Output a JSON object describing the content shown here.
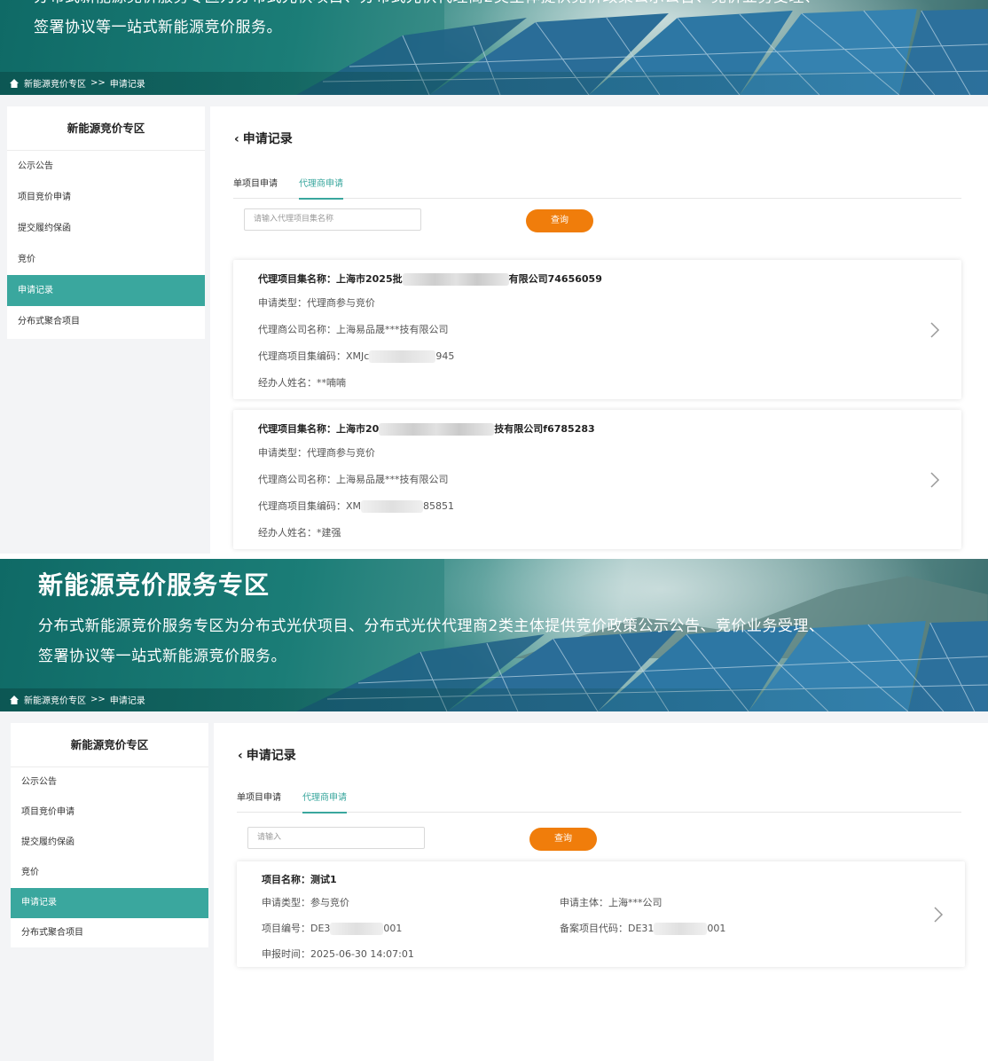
{
  "banner": {
    "title": "新能源竞价服务专区",
    "description": "分布式新能源竞价服务专区为分布式光伏项目、分布式光伏代理商2类主体提供竞价政策公示公告、竞价业务受理、签署协议等一站式新能源竞价服务。",
    "breadcrumb_root": "新能源竞价专区",
    "breadcrumb_sep": ">>",
    "breadcrumb_current": "申请记录"
  },
  "sidebar": {
    "title": "新能源竞价专区",
    "items": [
      {
        "label": "公示公告"
      },
      {
        "label": "项目竞价申请"
      },
      {
        "label": "提交履约保函"
      },
      {
        "label": "竞价"
      },
      {
        "label": "申请记录"
      },
      {
        "label": "分布式聚合项目"
      }
    ],
    "active_index": 4
  },
  "shot1": {
    "page_title": "申请记录",
    "tabs": [
      "单项目申请",
      "代理商申请"
    ],
    "active_tab": 1,
    "search_placeholder": "请输入代理项目集名称",
    "query_label": "查询",
    "cards": [
      {
        "name_label": "代理项目集名称：",
        "name_prefix": "上海市2025批",
        "name_suffix": "有限公司74656059",
        "type_label": "申请类型：",
        "type_value": "代理商参与竞价",
        "company_label": "代理商公司名称：",
        "company_value": "上海易品晟***技有限公司",
        "code_label": "代理商项目集编码：",
        "code_prefix": "XMJc",
        "code_suffix": "945",
        "handler_label": "经办人姓名：",
        "handler_value": "**喃喃"
      },
      {
        "name_label": "代理项目集名称：",
        "name_prefix": "上海市20",
        "name_suffix": "技有限公司f6785283",
        "type_label": "申请类型：",
        "type_value": "代理商参与竞价",
        "company_label": "代理商公司名称：",
        "company_value": "上海易品晟***技有限公司",
        "code_label": "代理商项目集编码：",
        "code_prefix": "XM",
        "code_suffix": "85851",
        "handler_label": "经办人姓名：",
        "handler_value": "*建强"
      }
    ]
  },
  "shot2": {
    "page_title": "申请记录",
    "tabs": [
      "单项目申请",
      "代理商申请"
    ],
    "active_tab": 1,
    "search_placeholder": "请输入",
    "query_label": "查询",
    "card": {
      "name_label": "项目名称：",
      "name_value": "测试1",
      "type_label": "申请类型：",
      "type_value": "参与竞价",
      "subject_label": "申请主体：",
      "subject_value": "上海***公司",
      "code_label": "项目编号：",
      "code_prefix": "DE3",
      "code_suffix": "001",
      "record_label": "备案项目代码：",
      "record_prefix": "DE31",
      "record_suffix": "001",
      "time_label": "申报时间：",
      "time_value": "2025-06-30 14:07:01"
    }
  },
  "colors": {
    "accent": "#3aa79e",
    "button": "#f07d0b",
    "banner": "#1b7d77"
  },
  "icons": [
    "home-icon",
    "chevron-left-icon",
    "chevron-right-icon"
  ]
}
